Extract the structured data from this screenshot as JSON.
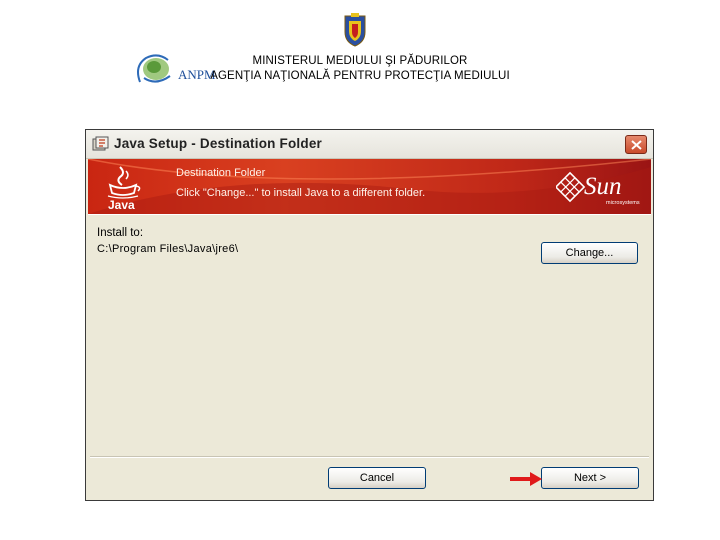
{
  "header": {
    "ministry_line": "MINISTERUL MEDIULUI ŞI PĂDURILOR",
    "agency_line": "AGENŢIA NAŢIONALĂ PENTRU PROTECŢIA MEDIULUI",
    "agency_logo_text": "ANPM",
    "coat_of_arms_icon": "romanian-coat-of-arms-icon"
  },
  "window": {
    "title": "Java Setup - Destination Folder",
    "title_icon": "java-setup-icon",
    "close_icon": "close-icon",
    "banner": {
      "title": "Destination Folder",
      "subtitle": "Click \"Change...\" to install Java to a different folder.",
      "java_logo_text": "Java",
      "sun_logo_text": "Sun",
      "sun_logo_sub": "microsystems"
    },
    "install_label": "Install to:",
    "install_path": "C:\\Program Files\\Java\\jre6\\",
    "change_button": "Change...",
    "cancel_button": "Cancel",
    "next_button": "Next >"
  },
  "annotation": {
    "arrow_icon": "red-arrow-icon",
    "arrow_color": "#e01a1a"
  },
  "colors": {
    "banner_red": "#c92612",
    "window_bg": "#ece9d8",
    "button_border": "#003c74"
  }
}
